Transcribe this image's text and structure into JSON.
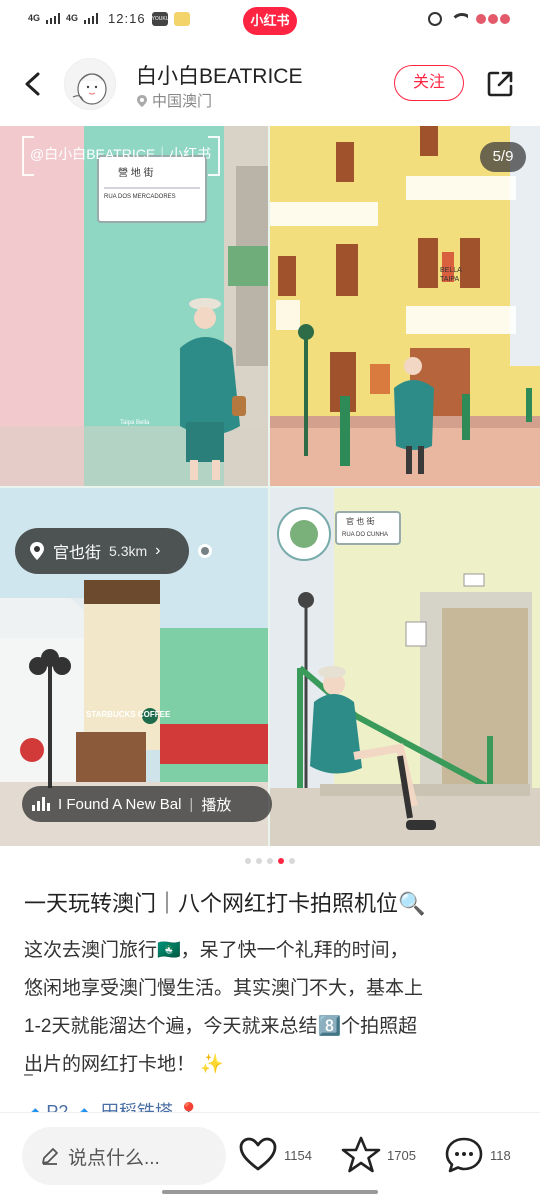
{
  "status_bar": {
    "signal_1": "4G",
    "signal_2": "4G",
    "time": "12:16",
    "app_badge": "YOUKU",
    "brand": "小红书"
  },
  "header": {
    "author_name": "白小白BEATRICE",
    "location": "中国澳门",
    "follow_label": "关注"
  },
  "gallery": {
    "counter": "5/9",
    "watermark": "@白小白BEATRICE｜小红书",
    "place_name": "官也街",
    "place_distance": "5.3km",
    "place_chevron": "›",
    "music_title": "I Found A New Bal",
    "music_action": "播放",
    "music_separator": "|",
    "photo_sign_1_cn": "營 地 街",
    "photo_sign_1_pt": "RUA DOS MERCADORES",
    "photo_sign_2_cn": "官 也 街",
    "photo_sign_2_pt": "RUA DO CUNHA",
    "photo_shop_1": "STARBUCKS COFFEE",
    "photo_shop_2": "BELLA TAIPA",
    "photo_caption_small": "Taipa Bella"
  },
  "pagination": {
    "total": 5,
    "active_index": 3
  },
  "note": {
    "title": "一天玩转澳门｜八个网红打卡拍照机位🔍",
    "body_line_1": "这次去澳门旅行🇲🇴，呆了快一个礼拜的时间，",
    "body_line_2": "悠闲地享受澳门慢生活。其实澳门不大，基本上",
    "body_line_3": "1-2天就能溜达个遍，今天就来总结8️⃣个拍照超",
    "body_line_4": "出片的网红打卡地！ ✨",
    "dash": "–",
    "tags_partial": "🔹P2 🔹 田稻铁塔 📍"
  },
  "bottom_bar": {
    "comment_placeholder": "说点什么...",
    "likes": "1154",
    "collects": "1705",
    "comments": "118"
  },
  "colors": {
    "brand_red": "#ff2442",
    "text_primary": "#222222",
    "text_secondary": "#888888"
  },
  "icons": [
    "back-arrow-icon",
    "share-icon",
    "location-pin-icon",
    "pencil-icon",
    "heart-icon",
    "star-icon",
    "comment-bubble-icon",
    "music-bars-icon",
    "alarm-clock-icon",
    "wifi-icon"
  ]
}
